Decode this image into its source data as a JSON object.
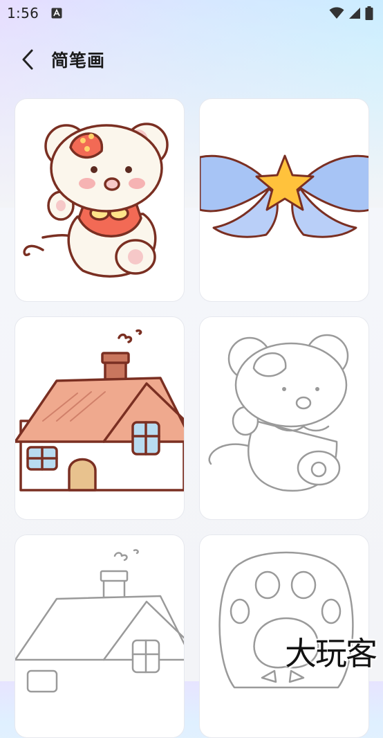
{
  "status_bar": {
    "time": "1:56",
    "notification_icon": "a-badge-icon",
    "icons": [
      "wifi-icon",
      "cell-signal-icon",
      "battery-icon"
    ]
  },
  "header": {
    "back_icon": "chevron-left-icon",
    "title": "简笔画"
  },
  "gallery": {
    "items": [
      {
        "name": "mouse-colored",
        "style": "colored"
      },
      {
        "name": "star-bow-colored",
        "style": "colored"
      },
      {
        "name": "house-colored",
        "style": "colored"
      },
      {
        "name": "mouse-outline",
        "style": "outline"
      },
      {
        "name": "house-outline",
        "style": "outline"
      },
      {
        "name": "paw-outline",
        "style": "outline"
      }
    ]
  },
  "watermark": "大玩客",
  "colors": {
    "outline_brown": "#7a2f22",
    "line_gray": "#9a9a9a",
    "mouse_body": "#fbf6ec",
    "mouse_shirt": "#f26a55",
    "ribbon_blue": "#a7c4f5",
    "star_yellow": "#ffc23c",
    "roof_peach": "#efa98e",
    "window_blue": "#b8dbf0",
    "door_tan": "#e8c28e"
  }
}
